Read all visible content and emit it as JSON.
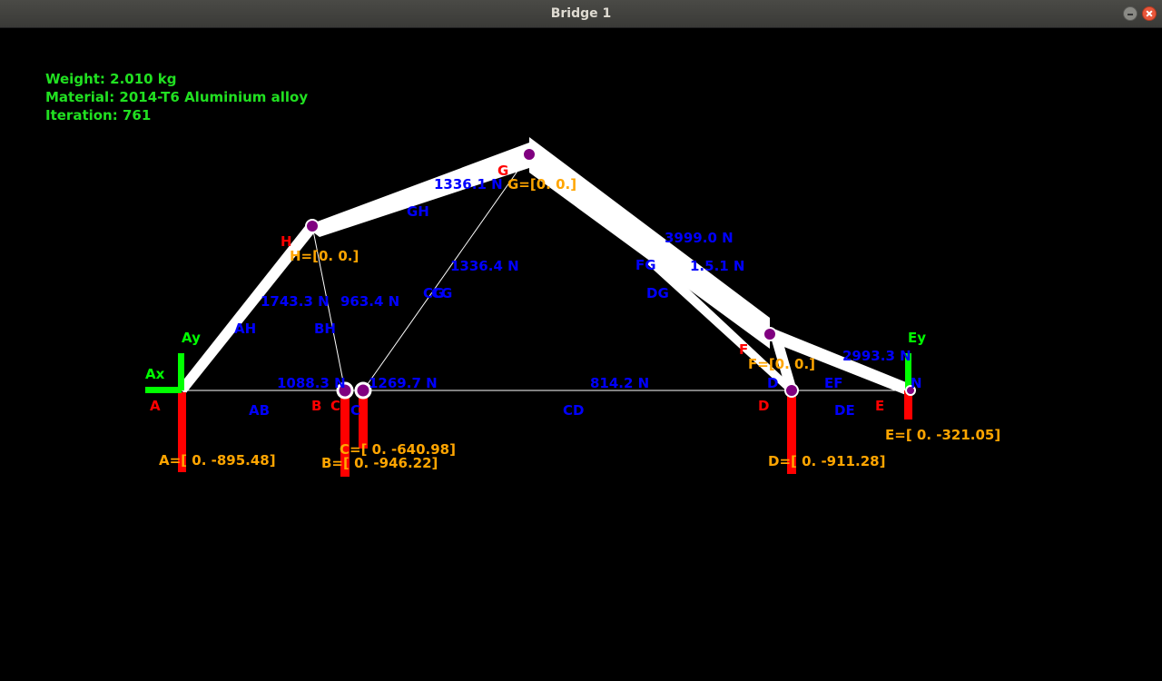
{
  "window": {
    "title": "Bridge 1"
  },
  "info": {
    "weight": "Weight: 2.010 kg",
    "material": "Material: 2014-T6 Aluminium alloy",
    "iteration": "Iteration: 761"
  },
  "nodes": {
    "A": {
      "label": "A"
    },
    "B": {
      "label": "B"
    },
    "C": {
      "label": "C"
    },
    "D": {
      "label": "D"
    },
    "E": {
      "label": "E"
    },
    "F": {
      "label": "F"
    },
    "G": {
      "label": "G"
    },
    "H": {
      "label": "H"
    }
  },
  "members": {
    "AB": {
      "label": "AB",
      "force": ""
    },
    "AH": {
      "label": "AH",
      "force": "1743.3 N"
    },
    "BH": {
      "label": "BH",
      "force": "963.4 N"
    },
    "BC": {
      "label": "",
      "force": "1088.3 N"
    },
    "CD": {
      "label": "CD",
      "force": "814.2 N"
    },
    "CG": {
      "label": "CG",
      "force": "1269.7 N"
    },
    "GH": {
      "label": "GH",
      "force": "1336.1 N"
    },
    "FG": {
      "label": "FG",
      "force": "3999.0 N"
    },
    "DG": {
      "label": "DG",
      "force": ""
    },
    "DE": {
      "label": "DE",
      "force": ""
    },
    "EF": {
      "label": "EF",
      "force": "2993.3 N"
    },
    "DF": {
      "label": "",
      "force": ""
    }
  },
  "overlap_labels": {
    "mid_force_1": "1336.4 N",
    "mid_force_2": "1.5.1 N",
    "d_tag": "D",
    "e_tag": "N"
  },
  "node_loads": {
    "A": "A=[  0.  -895.48]",
    "B": "B=[  0.  -946.22]",
    "C": "C=[  0.  -640.98]",
    "D": "D=[  0.  -911.28]",
    "E": "E=[  0.  -321.05]",
    "F": "F=[0. 0.]",
    "G": "G=[0. 0.]",
    "H": "H=[0. 0.]"
  },
  "reactions": {
    "Ax": "Ax",
    "Ay": "Ay",
    "Ey": "Ey"
  },
  "colors": {
    "background": "#000000",
    "member": "#ffffff",
    "node": "#800080",
    "force_text": "#0000ff",
    "node_label": "#ff0000",
    "load_text": "#ffa500",
    "reaction": "#00ff00",
    "info": "#21e021"
  }
}
